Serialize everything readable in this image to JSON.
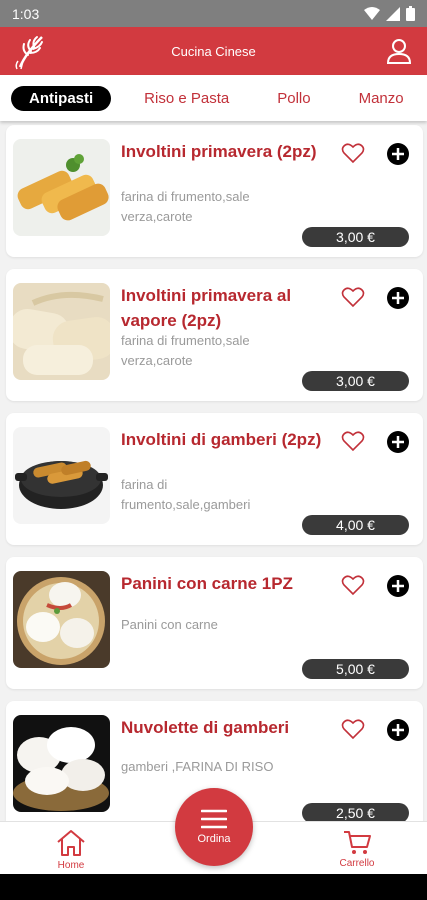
{
  "status_bar": {
    "time": "1:03"
  },
  "header": {
    "title": "Cucina Cinese"
  },
  "tabs": [
    {
      "label": "Antipasti"
    },
    {
      "label": "Riso e Pasta"
    },
    {
      "label": "Pollo"
    },
    {
      "label": "Manzo"
    }
  ],
  "items": [
    {
      "name": "Involtini primavera (2pz)",
      "desc": "farina di frumento,sale verza,carote",
      "price": "3,00 €"
    },
    {
      "name": "Involtini primavera al vapore (2pz)",
      "desc": "farina di frumento,sale verza,carote",
      "price": "3,00 €"
    },
    {
      "name": "Involtini di gamberi (2pz)",
      "desc": "farina di frumento,sale,gamberi",
      "price": "4,00 €"
    },
    {
      "name": "Panini con carne 1PZ",
      "desc": "Panini con carne",
      "price": "5,00 €"
    },
    {
      "name": "Nuvolette di gamberi",
      "desc": "gamberi ,FARINA DI RISO",
      "price": "2,50 €"
    }
  ],
  "bottom_nav": {
    "home_label": "Home",
    "order_label": "Ordina",
    "cart_label": "Carrello"
  },
  "colors": {
    "brand": "#d23a40",
    "price_bg": "#3a3a3a",
    "active_tab": "#000000"
  }
}
